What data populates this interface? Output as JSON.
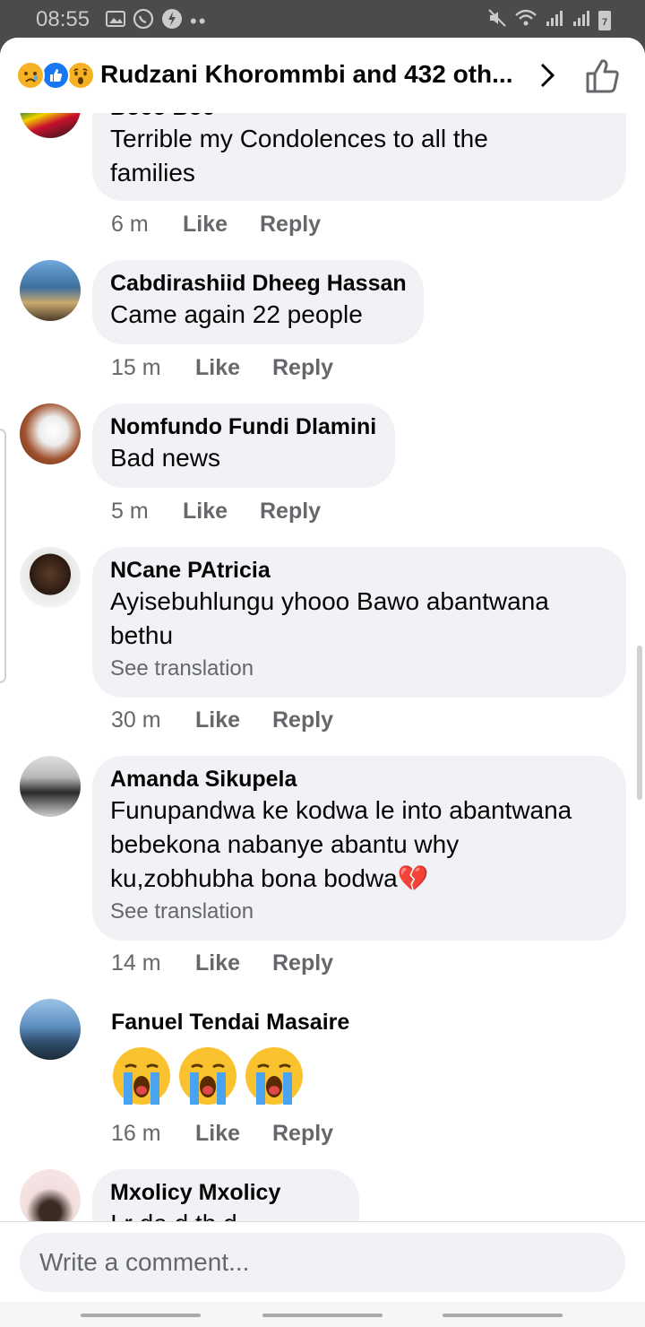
{
  "status_bar": {
    "time": "08:55",
    "left_icons": [
      "gallery-icon",
      "whatsapp-icon",
      "flash-icon",
      "more-dots-icon"
    ],
    "right_icons": [
      "mute-icon",
      "wifi-icon",
      "signal-icon",
      "signal-icon",
      "battery-icon"
    ],
    "battery": "7"
  },
  "header": {
    "title": "Rudzani Khorommbi and 432 oth...",
    "reactions": [
      "sad-reaction",
      "like-reaction",
      "wow-reaction"
    ]
  },
  "comments": [
    {
      "name": "Boco Boc",
      "text": "Terrible my Condolences to all the families",
      "time": "6 m",
      "like": "Like",
      "reply": "Reply"
    },
    {
      "name": "Cabdirashiid Dheeg Hassan",
      "text": "Came again 22 people",
      "time": "15 m",
      "like": "Like",
      "reply": "Reply"
    },
    {
      "name": "Nomfundo Fundi Dlamini",
      "text": "Bad news",
      "time": "5 m",
      "like": "Like",
      "reply": "Reply"
    },
    {
      "name": "NCane PAtricia",
      "text": "Ayisebuhlungu yhooo Bawo abantwana bethu",
      "translation": "See translation",
      "time": "30 m",
      "like": "Like",
      "reply": "Reply"
    },
    {
      "name": "Amanda Sikupela",
      "text": "Funupandwa ke kodwa le into abantwana bebekona nabanye abantu why ku,zobhubha bona bodwa💔",
      "translation": "See translation",
      "time": "14 m",
      "like": "Like",
      "reply": "Reply"
    },
    {
      "name": "Fanuel Tendai Masaire",
      "emojis": [
        "loudly-crying-face",
        "loudly-crying-face",
        "loudly-crying-face"
      ],
      "time": "16 m",
      "like": "Like",
      "reply": "Reply"
    },
    {
      "name": "Mxolicy Mxolicy",
      "text": "I r da d th d"
    }
  ],
  "composer": {
    "placeholder": "Write a comment..."
  },
  "colors": {
    "bubble": "#f0f2f5",
    "secondary_text": "#65676b",
    "like_blue": "#1877f2",
    "sad_yellow": "#f7b125"
  }
}
